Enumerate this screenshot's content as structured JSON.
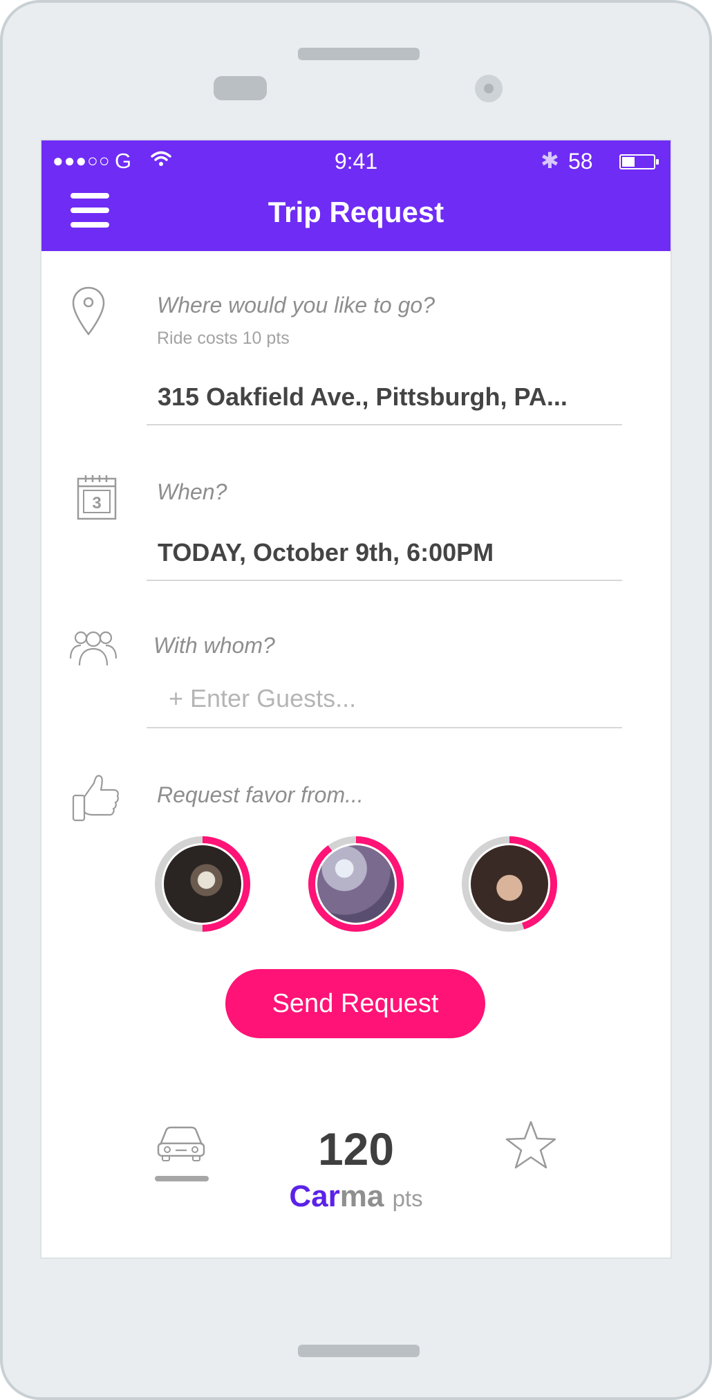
{
  "status_bar": {
    "signal": "●●●○○",
    "carrier": "G",
    "time": "9:41",
    "bluetooth": "✱",
    "battery_level": "58",
    "battery_fraction": 0.42
  },
  "header": {
    "menu_icon": "hamburger-menu-icon",
    "title": "Trip Request"
  },
  "destination": {
    "icon": "location-pin-icon",
    "label": "Where would you like to go?",
    "hint": "Ride costs 10 pts",
    "value": "315 Oakfield Ave., Pittsburgh, PA..."
  },
  "when": {
    "icon": "calendar-icon",
    "calendar_day": "3",
    "label": "When?",
    "value": "TODAY, October 9th, 6:00PM"
  },
  "guests": {
    "icon": "group-icon",
    "label": "With whom?",
    "placeholder": "+ Enter Guests..."
  },
  "favor": {
    "icon": "thumbs-up-icon",
    "label": "Request favor from...",
    "friends": [
      {
        "icon": "avatar-friend-1",
        "progress": 0.5
      },
      {
        "icon": "avatar-friend-2",
        "progress": 0.9
      },
      {
        "icon": "avatar-friend-3",
        "progress": 0.45
      }
    ]
  },
  "actions": {
    "send_label": "Send Request"
  },
  "bottom_bar": {
    "car_icon": "car-icon",
    "points": "120",
    "brand_car": "Car",
    "brand_ma": "ma",
    "points_unit": "pts",
    "star_icon": "star-icon"
  },
  "colors": {
    "header": "#6f2cf5",
    "accent": "#ff1376",
    "brand": "#5b22e8"
  }
}
